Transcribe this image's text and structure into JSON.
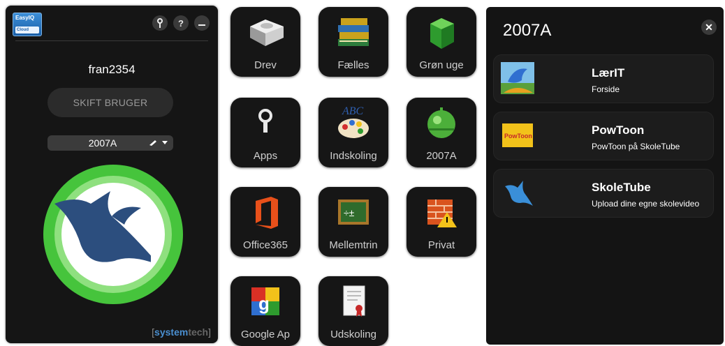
{
  "left_panel": {
    "logo": {
      "line1": "EasyIQ",
      "line2": "Cloud"
    },
    "icons": [
      "key-icon",
      "help-icon",
      "minimize-icon"
    ],
    "username": "fran2354",
    "switch_user_label": "SKIFT BRUGER",
    "class_select_value": "2007A",
    "footer_brand": {
      "open": "[",
      "name1": "system",
      "name2": "tech",
      "close": "]"
    },
    "colors": {
      "circle_outer": "#46c43c",
      "circle_mid": "#8fe07f",
      "bird": "#2c4e7e"
    }
  },
  "tiles": [
    {
      "label": "Drev",
      "icon": "drive-icon"
    },
    {
      "label": "Fælles",
      "icon": "books-icon"
    },
    {
      "label": "Grøn uge",
      "icon": "green-cube-icon"
    },
    {
      "label": "Apps",
      "icon": "key-icon"
    },
    {
      "label": "Indskoling",
      "icon": "palette-abc-icon"
    },
    {
      "label": "2007A",
      "icon": "green-bell-icon"
    },
    {
      "label": "Office365",
      "icon": "office-icon"
    },
    {
      "label": "Mellemtrin",
      "icon": "chalkboard-icon"
    },
    {
      "label": "Privat",
      "icon": "firewall-icon"
    },
    {
      "label": "Google Ap",
      "icon": "google-apps-icon"
    },
    {
      "label": "Udskoling",
      "icon": "certificate-icon"
    }
  ],
  "right_panel": {
    "title": "2007A",
    "close_icon": "close-icon",
    "cards": [
      {
        "title": "LærIT",
        "subtitle": "Forside",
        "icon": "laerit-bird-icon"
      },
      {
        "title": "PowToon",
        "subtitle": "PowToon på SkoleTube",
        "icon": "powtoon-icon",
        "thumb_text": "PowToon"
      },
      {
        "title": "SkoleTube",
        "subtitle": "Upload dine egne skolevideo",
        "icon": "skoletube-bird-icon"
      }
    ]
  }
}
